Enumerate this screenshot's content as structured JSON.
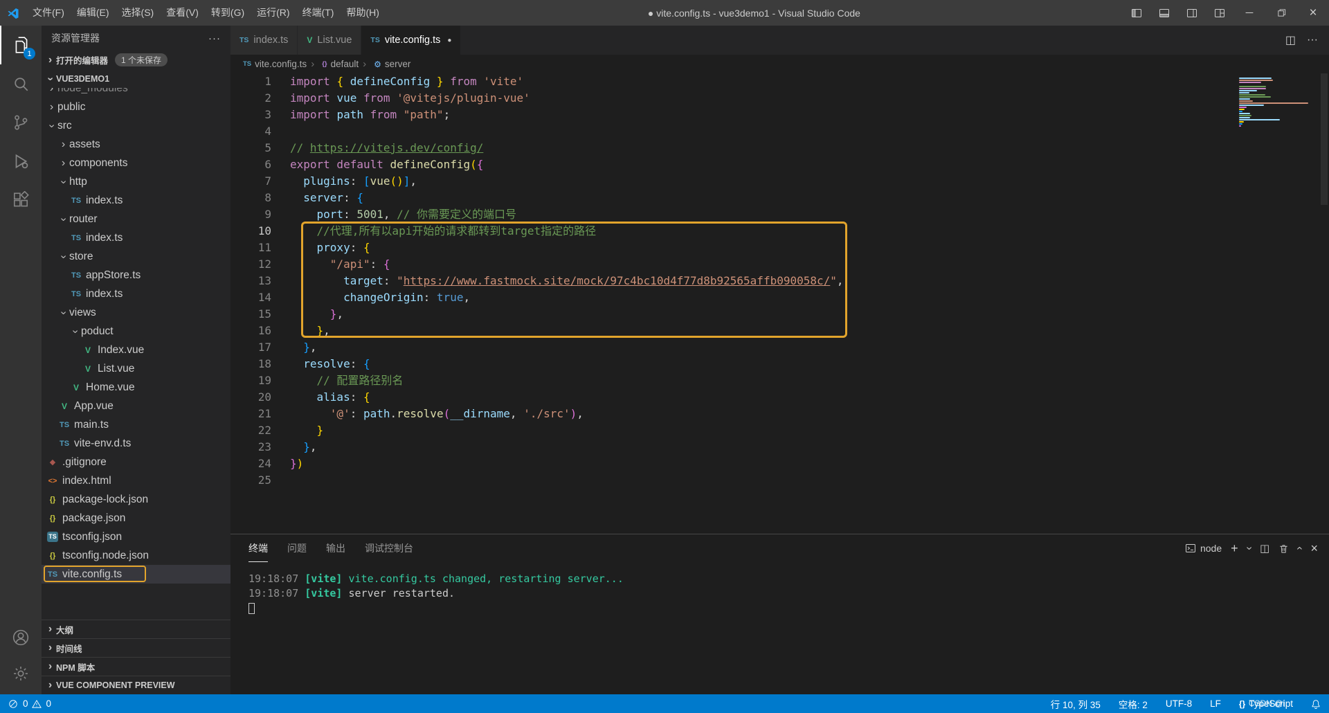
{
  "colors": {
    "accent": "#007ACC",
    "annotation": "#E2A42C"
  },
  "title_bar": {
    "menus": [
      "文件(F)",
      "编辑(E)",
      "选择(S)",
      "查看(V)",
      "转到(G)",
      "运行(R)",
      "终端(T)",
      "帮助(H)"
    ],
    "title": "● vite.config.ts - vue3demo1 - Visual Studio Code"
  },
  "activity_bar": {
    "badge": "1"
  },
  "icons": {
    "chevron": {
      "glyph": "›"
    },
    "more": {
      "glyph": "···"
    },
    "plus": {
      "glyph": "+"
    },
    "split": {
      "glyph": "◫"
    },
    "minimize": {
      "glyph": "─"
    },
    "close": {
      "glyph": "×"
    },
    "dot": {
      "glyph": "●"
    },
    "braces": {
      "glyph": "{}"
    },
    "ts": {
      "glyph": "TS",
      "color": "#519ABA"
    },
    "vue": {
      "glyph": "V",
      "color": "#42B883"
    },
    "json": {
      "glyph": "{}",
      "color": "#CBCB41"
    },
    "html": {
      "glyph": "<>",
      "color": "#E37933"
    },
    "git": {
      "glyph": "◆",
      "color": "#A8574F"
    },
    "tsconfig": {
      "glyph": "TS",
      "color": "#FFFFFF"
    },
    "symbol-default": {
      "glyph": "{}",
      "color": "#B180D7"
    },
    "symbol-server": {
      "glyph": "⚙",
      "color": "#75BEFF"
    }
  },
  "sidebar": {
    "title": "资源管理器",
    "open_editors_label": "打开的编辑器",
    "open_editors_badge": "1 个未保存",
    "root": "VUE3DEMO1",
    "tree": [
      {
        "label": "node_modules",
        "type": "folder",
        "depth": 1,
        "expanded": false,
        "dim": true
      },
      {
        "label": "public",
        "type": "folder",
        "depth": 1,
        "expanded": false
      },
      {
        "label": "src",
        "type": "folder",
        "depth": 1,
        "expanded": true
      },
      {
        "label": "assets",
        "type": "folder",
        "depth": 2,
        "expanded": false
      },
      {
        "label": "components",
        "type": "folder",
        "depth": 2,
        "expanded": false
      },
      {
        "label": "http",
        "type": "folder",
        "depth": 2,
        "expanded": true
      },
      {
        "label": "index.ts",
        "type": "ts",
        "depth": 3
      },
      {
        "label": "router",
        "type": "folder",
        "depth": 2,
        "expanded": true
      },
      {
        "label": "index.ts",
        "type": "ts",
        "depth": 3
      },
      {
        "label": "store",
        "type": "folder",
        "depth": 2,
        "expanded": true
      },
      {
        "label": "appStore.ts",
        "type": "ts",
        "depth": 3
      },
      {
        "label": "index.ts",
        "type": "ts",
        "depth": 3
      },
      {
        "label": "views",
        "type": "folder",
        "depth": 2,
        "expanded": true
      },
      {
        "label": "poduct",
        "type": "folder",
        "depth": 3,
        "expanded": true
      },
      {
        "label": "Index.vue",
        "type": "vue",
        "depth": 4
      },
      {
        "label": "List.vue",
        "type": "vue",
        "depth": 4
      },
      {
        "label": "Home.vue",
        "type": "vue",
        "depth": 3
      },
      {
        "label": "App.vue",
        "type": "vue",
        "depth": 2
      },
      {
        "label": "main.ts",
        "type": "ts",
        "depth": 2
      },
      {
        "label": "vite-env.d.ts",
        "type": "ts",
        "depth": 2
      },
      {
        "label": ".gitignore",
        "type": "git",
        "depth": 1
      },
      {
        "label": "index.html",
        "type": "html",
        "depth": 1
      },
      {
        "label": "package-lock.json",
        "type": "json",
        "depth": 1
      },
      {
        "label": "package.json",
        "type": "json",
        "depth": 1
      },
      {
        "label": "tsconfig.json",
        "type": "tsconfig",
        "depth": 1
      },
      {
        "label": "tsconfig.node.json",
        "type": "json",
        "depth": 1
      },
      {
        "label": "vite.config.ts",
        "type": "ts",
        "depth": 1,
        "selected": true,
        "annotated": true
      }
    ],
    "sections": [
      "大纲",
      "时间线",
      "NPM 脚本",
      "VUE COMPONENT PREVIEW"
    ]
  },
  "tabs": [
    {
      "label": "index.ts",
      "icon": "ts",
      "active": false,
      "dirty": false
    },
    {
      "label": "List.vue",
      "icon": "vue",
      "active": false,
      "dirty": false
    },
    {
      "label": "vite.config.ts",
      "icon": "ts",
      "active": true,
      "dirty": true
    }
  ],
  "breadcrumbs": {
    "items": [
      {
        "icon": "ts",
        "label": "vite.config.ts"
      },
      {
        "icon": "symbol-default",
        "label": "default"
      },
      {
        "icon": "symbol-server",
        "label": "server"
      }
    ]
  },
  "palette": {
    "kw": "#C586C0",
    "var": "#9CDCFE",
    "fn": "#DCDCAA",
    "str": "#CE9178",
    "stru": "#CE9178",
    "num": "#B5CEA8",
    "cmt": "#6A9955",
    "cmtu": "#6A9955",
    "const": "#569CD6",
    "b1": "#FFD700",
    "b2": "#DA70D6",
    "b3": "#179FFF",
    "fg": "#D4D4D4",
    "t_time": "#8F8F8F",
    "t_tag": "#35C9A0",
    "t_msg": "#35C9A0",
    "t_fg": "#CCCCCC"
  },
  "editor": {
    "current_line": 10,
    "lines": [
      [
        [
          "kw",
          "import "
        ],
        [
          "b1",
          "{ "
        ],
        [
          "var",
          "defineConfig"
        ],
        [
          "b1",
          " }"
        ],
        [
          "kw",
          " from "
        ],
        [
          "str",
          "'vite'"
        ]
      ],
      [
        [
          "kw",
          "import "
        ],
        [
          "var",
          "vue"
        ],
        [
          "kw",
          " from "
        ],
        [
          "str",
          "'@vitejs/plugin-vue'"
        ]
      ],
      [
        [
          "kw",
          "import "
        ],
        [
          "var",
          "path"
        ],
        [
          "kw",
          " from "
        ],
        [
          "str",
          "\"path\""
        ],
        [
          "fg",
          ";"
        ]
      ],
      [],
      [
        [
          "cmt",
          "// "
        ],
        [
          "cmtu",
          "https://vitejs.dev/config/"
        ]
      ],
      [
        [
          "kw",
          "export default "
        ],
        [
          "fn",
          "defineConfig"
        ],
        [
          "b1",
          "("
        ],
        [
          "b2",
          "{"
        ]
      ],
      [
        [
          "fg",
          "  "
        ],
        [
          "var",
          "plugins"
        ],
        [
          "fg",
          ": "
        ],
        [
          "b3",
          "["
        ],
        [
          "fn",
          "vue"
        ],
        [
          "b1",
          "()"
        ],
        [
          "b3",
          "]"
        ],
        [
          "fg",
          ","
        ]
      ],
      [
        [
          "fg",
          "  "
        ],
        [
          "var",
          "server"
        ],
        [
          "fg",
          ": "
        ],
        [
          "b3",
          "{"
        ]
      ],
      [
        [
          "fg",
          "    "
        ],
        [
          "var",
          "port"
        ],
        [
          "fg",
          ": "
        ],
        [
          "num",
          "5001"
        ],
        [
          "fg",
          ", "
        ],
        [
          "cmt",
          "// 你需要定义的端口号"
        ]
      ],
      [
        [
          "fg",
          "    "
        ],
        [
          "cmt",
          "//代理,所有以api开始的请求都转到target指定的路径"
        ]
      ],
      [
        [
          "fg",
          "    "
        ],
        [
          "var",
          "proxy"
        ],
        [
          "fg",
          ": "
        ],
        [
          "b1",
          "{"
        ]
      ],
      [
        [
          "fg",
          "      "
        ],
        [
          "str",
          "\"/api\""
        ],
        [
          "fg",
          ": "
        ],
        [
          "b2",
          "{"
        ]
      ],
      [
        [
          "fg",
          "        "
        ],
        [
          "var",
          "target"
        ],
        [
          "fg",
          ": "
        ],
        [
          "str",
          "\""
        ],
        [
          "stru",
          "https://www.fastmock.site/mock/97c4bc10d4f77d8b92565affb090058c/"
        ],
        [
          "str",
          "\""
        ],
        [
          "fg",
          ","
        ]
      ],
      [
        [
          "fg",
          "        "
        ],
        [
          "var",
          "changeOrigin"
        ],
        [
          "fg",
          ": "
        ],
        [
          "const",
          "true"
        ],
        [
          "fg",
          ","
        ]
      ],
      [
        [
          "fg",
          "      "
        ],
        [
          "b2",
          "}"
        ],
        [
          "fg",
          ","
        ]
      ],
      [
        [
          "fg",
          "    "
        ],
        [
          "b1",
          "}"
        ],
        [
          "fg",
          ","
        ]
      ],
      [
        [
          "fg",
          "  "
        ],
        [
          "b3",
          "}"
        ],
        [
          "fg",
          ","
        ]
      ],
      [
        [
          "fg",
          "  "
        ],
        [
          "var",
          "resolve"
        ],
        [
          "fg",
          ": "
        ],
        [
          "b3",
          "{"
        ]
      ],
      [
        [
          "fg",
          "    "
        ],
        [
          "cmt",
          "// 配置路径别名"
        ]
      ],
      [
        [
          "fg",
          "    "
        ],
        [
          "var",
          "alias"
        ],
        [
          "fg",
          ": "
        ],
        [
          "b1",
          "{"
        ]
      ],
      [
        [
          "fg",
          "      "
        ],
        [
          "str",
          "'@'"
        ],
        [
          "fg",
          ": "
        ],
        [
          "var",
          "path"
        ],
        [
          "fg",
          "."
        ],
        [
          "fn",
          "resolve"
        ],
        [
          "b2",
          "("
        ],
        [
          "var",
          "__dirname"
        ],
        [
          "fg",
          ", "
        ],
        [
          "str",
          "'./src'"
        ],
        [
          "b2",
          ")"
        ],
        [
          "fg",
          ","
        ]
      ],
      [
        [
          "fg",
          "    "
        ],
        [
          "b1",
          "}"
        ]
      ],
      [
        [
          "fg",
          "  "
        ],
        [
          "b3",
          "}"
        ],
        [
          "fg",
          ","
        ]
      ],
      [
        [
          "b2",
          "}"
        ],
        [
          "b1",
          ")"
        ]
      ],
      []
    ]
  },
  "panel": {
    "tabs": [
      "终端",
      "问题",
      "输出",
      "调试控制台"
    ],
    "active_tab": "终端",
    "shell": "node",
    "terminal_lines": [
      [
        [
          "t_time",
          "19:18:07 "
        ],
        [
          "t_tag",
          "[vite] "
        ],
        [
          "t_msg",
          "vite.config.ts changed, restarting server..."
        ]
      ],
      [
        [
          "t_time",
          "19:18:07 "
        ],
        [
          "t_tag",
          "[vite] "
        ],
        [
          "t_fg",
          "server restarted."
        ]
      ]
    ]
  },
  "status_bar": {
    "errors": "0",
    "warnings": "0",
    "cursor": "行 10, 列 35",
    "indent": "空格: 2",
    "encoding": "UTF-8",
    "eol": "LF",
    "language": "TypeScript"
  },
  "watermark": "CSDN @i"
}
